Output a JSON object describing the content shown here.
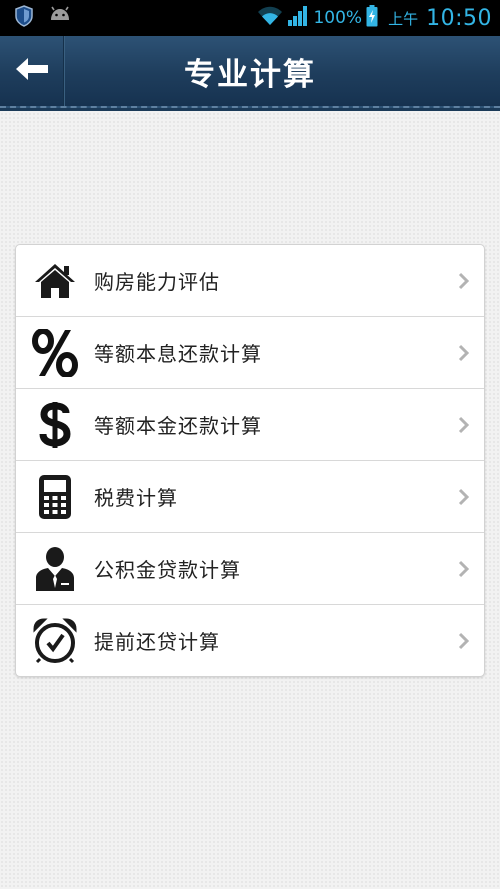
{
  "status_bar": {
    "battery_percent": "100%",
    "ampm": "上午",
    "time": "10:50",
    "accent_color": "#33b5e5"
  },
  "header": {
    "title": "专业计算",
    "back_icon": "arrow-left-icon"
  },
  "menu": {
    "items": [
      {
        "label": "购房能力评估",
        "icon": "house-icon"
      },
      {
        "label": "等额本息还款计算",
        "icon": "percent-icon"
      },
      {
        "label": "等额本金还款计算",
        "icon": "dollar-icon"
      },
      {
        "label": "税费计算",
        "icon": "calculator-icon"
      },
      {
        "label": "公积金贷款计算",
        "icon": "businessman-icon"
      },
      {
        "label": "提前还贷计算",
        "icon": "alarm-clock-icon"
      }
    ]
  }
}
